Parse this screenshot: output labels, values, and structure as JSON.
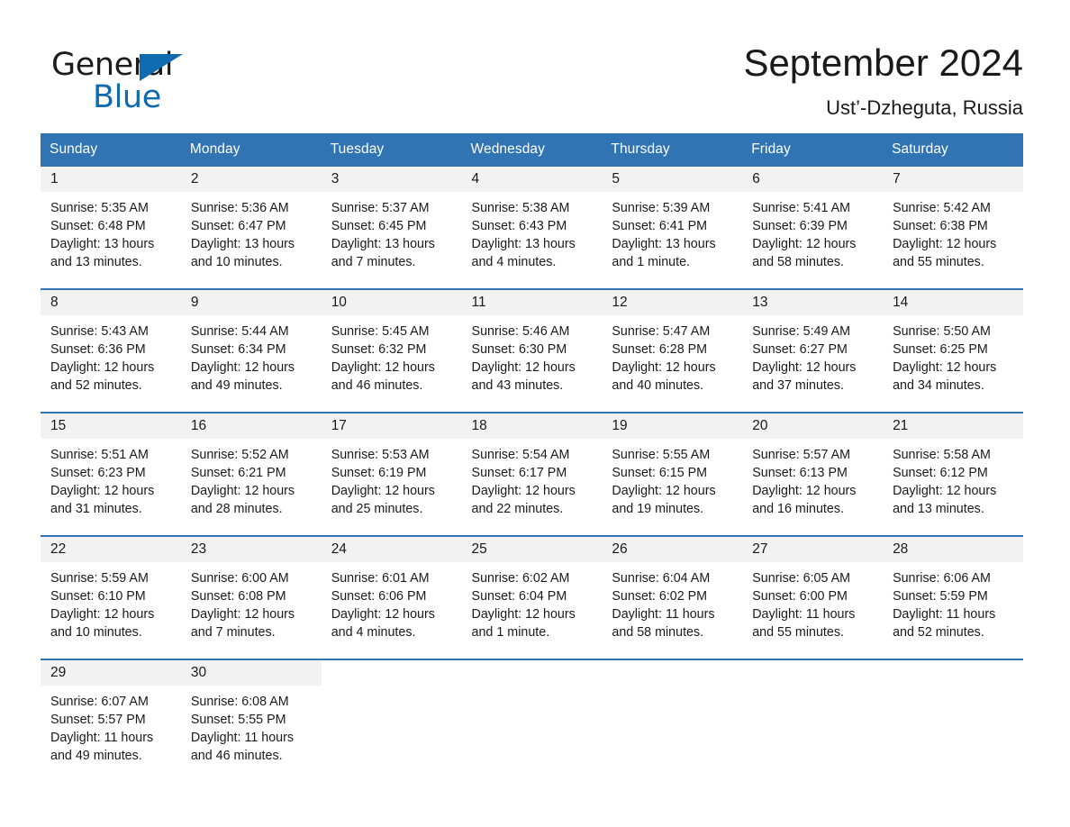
{
  "brand": {
    "word1": "General",
    "word2": "Blue",
    "triangle_icon": "triangle-icon",
    "accent_color": "#0f6bb0"
  },
  "header": {
    "title": "September 2024",
    "subtitle": "Ust’-Dzheguta, Russia"
  },
  "theme": {
    "header_blue": "#3074b4",
    "daynum_gray": "#f2f2f2",
    "text": "#1a1a1a"
  },
  "calendar": {
    "weekday_headers": [
      "Sunday",
      "Monday",
      "Tuesday",
      "Wednesday",
      "Thursday",
      "Friday",
      "Saturday"
    ],
    "weeks": [
      [
        {
          "day": "1",
          "sunrise": "Sunrise: 5:35 AM",
          "sunset": "Sunset: 6:48 PM",
          "daylight": "Daylight: 13 hours and 13 minutes."
        },
        {
          "day": "2",
          "sunrise": "Sunrise: 5:36 AM",
          "sunset": "Sunset: 6:47 PM",
          "daylight": "Daylight: 13 hours and 10 minutes."
        },
        {
          "day": "3",
          "sunrise": "Sunrise: 5:37 AM",
          "sunset": "Sunset: 6:45 PM",
          "daylight": "Daylight: 13 hours and 7 minutes."
        },
        {
          "day": "4",
          "sunrise": "Sunrise: 5:38 AM",
          "sunset": "Sunset: 6:43 PM",
          "daylight": "Daylight: 13 hours and 4 minutes."
        },
        {
          "day": "5",
          "sunrise": "Sunrise: 5:39 AM",
          "sunset": "Sunset: 6:41 PM",
          "daylight": "Daylight: 13 hours and 1 minute."
        },
        {
          "day": "6",
          "sunrise": "Sunrise: 5:41 AM",
          "sunset": "Sunset: 6:39 PM",
          "daylight": "Daylight: 12 hours and 58 minutes."
        },
        {
          "day": "7",
          "sunrise": "Sunrise: 5:42 AM",
          "sunset": "Sunset: 6:38 PM",
          "daylight": "Daylight: 12 hours and 55 minutes."
        }
      ],
      [
        {
          "day": "8",
          "sunrise": "Sunrise: 5:43 AM",
          "sunset": "Sunset: 6:36 PM",
          "daylight": "Daylight: 12 hours and 52 minutes."
        },
        {
          "day": "9",
          "sunrise": "Sunrise: 5:44 AM",
          "sunset": "Sunset: 6:34 PM",
          "daylight": "Daylight: 12 hours and 49 minutes."
        },
        {
          "day": "10",
          "sunrise": "Sunrise: 5:45 AM",
          "sunset": "Sunset: 6:32 PM",
          "daylight": "Daylight: 12 hours and 46 minutes."
        },
        {
          "day": "11",
          "sunrise": "Sunrise: 5:46 AM",
          "sunset": "Sunset: 6:30 PM",
          "daylight": "Daylight: 12 hours and 43 minutes."
        },
        {
          "day": "12",
          "sunrise": "Sunrise: 5:47 AM",
          "sunset": "Sunset: 6:28 PM",
          "daylight": "Daylight: 12 hours and 40 minutes."
        },
        {
          "day": "13",
          "sunrise": "Sunrise: 5:49 AM",
          "sunset": "Sunset: 6:27 PM",
          "daylight": "Daylight: 12 hours and 37 minutes."
        },
        {
          "day": "14",
          "sunrise": "Sunrise: 5:50 AM",
          "sunset": "Sunset: 6:25 PM",
          "daylight": "Daylight: 12 hours and 34 minutes."
        }
      ],
      [
        {
          "day": "15",
          "sunrise": "Sunrise: 5:51 AM",
          "sunset": "Sunset: 6:23 PM",
          "daylight": "Daylight: 12 hours and 31 minutes."
        },
        {
          "day": "16",
          "sunrise": "Sunrise: 5:52 AM",
          "sunset": "Sunset: 6:21 PM",
          "daylight": "Daylight: 12 hours and 28 minutes."
        },
        {
          "day": "17",
          "sunrise": "Sunrise: 5:53 AM",
          "sunset": "Sunset: 6:19 PM",
          "daylight": "Daylight: 12 hours and 25 minutes."
        },
        {
          "day": "18",
          "sunrise": "Sunrise: 5:54 AM",
          "sunset": "Sunset: 6:17 PM",
          "daylight": "Daylight: 12 hours and 22 minutes."
        },
        {
          "day": "19",
          "sunrise": "Sunrise: 5:55 AM",
          "sunset": "Sunset: 6:15 PM",
          "daylight": "Daylight: 12 hours and 19 minutes."
        },
        {
          "day": "20",
          "sunrise": "Sunrise: 5:57 AM",
          "sunset": "Sunset: 6:13 PM",
          "daylight": "Daylight: 12 hours and 16 minutes."
        },
        {
          "day": "21",
          "sunrise": "Sunrise: 5:58 AM",
          "sunset": "Sunset: 6:12 PM",
          "daylight": "Daylight: 12 hours and 13 minutes."
        }
      ],
      [
        {
          "day": "22",
          "sunrise": "Sunrise: 5:59 AM",
          "sunset": "Sunset: 6:10 PM",
          "daylight": "Daylight: 12 hours and 10 minutes."
        },
        {
          "day": "23",
          "sunrise": "Sunrise: 6:00 AM",
          "sunset": "Sunset: 6:08 PM",
          "daylight": "Daylight: 12 hours and 7 minutes."
        },
        {
          "day": "24",
          "sunrise": "Sunrise: 6:01 AM",
          "sunset": "Sunset: 6:06 PM",
          "daylight": "Daylight: 12 hours and 4 minutes."
        },
        {
          "day": "25",
          "sunrise": "Sunrise: 6:02 AM",
          "sunset": "Sunset: 6:04 PM",
          "daylight": "Daylight: 12 hours and 1 minute."
        },
        {
          "day": "26",
          "sunrise": "Sunrise: 6:04 AM",
          "sunset": "Sunset: 6:02 PM",
          "daylight": "Daylight: 11 hours and 58 minutes."
        },
        {
          "day": "27",
          "sunrise": "Sunrise: 6:05 AM",
          "sunset": "Sunset: 6:00 PM",
          "daylight": "Daylight: 11 hours and 55 minutes."
        },
        {
          "day": "28",
          "sunrise": "Sunrise: 6:06 AM",
          "sunset": "Sunset: 5:59 PM",
          "daylight": "Daylight: 11 hours and 52 minutes."
        }
      ],
      [
        {
          "day": "29",
          "sunrise": "Sunrise: 6:07 AM",
          "sunset": "Sunset: 5:57 PM",
          "daylight": "Daylight: 11 hours and 49 minutes."
        },
        {
          "day": "30",
          "sunrise": "Sunrise: 6:08 AM",
          "sunset": "Sunset: 5:55 PM",
          "daylight": "Daylight: 11 hours and 46 minutes."
        },
        {
          "day": "",
          "sunrise": "",
          "sunset": "",
          "daylight": ""
        },
        {
          "day": "",
          "sunrise": "",
          "sunset": "",
          "daylight": ""
        },
        {
          "day": "",
          "sunrise": "",
          "sunset": "",
          "daylight": ""
        },
        {
          "day": "",
          "sunrise": "",
          "sunset": "",
          "daylight": ""
        },
        {
          "day": "",
          "sunrise": "",
          "sunset": "",
          "daylight": ""
        }
      ]
    ]
  }
}
